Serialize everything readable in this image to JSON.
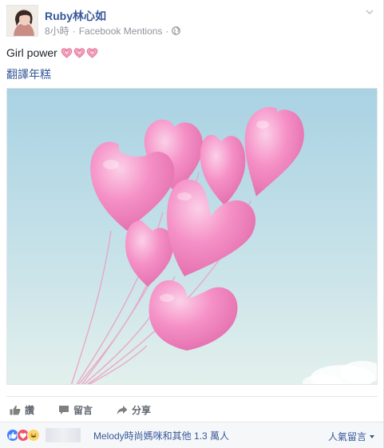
{
  "post": {
    "author": "Ruby林心如",
    "time": "8小時",
    "source": "Facebook Mentions",
    "separator": "·",
    "text": "Girl power",
    "translate_link": "翻譯年糕"
  },
  "actions": {
    "like_label": "讚",
    "comment_label": "留言",
    "share_label": "分享"
  },
  "reactions": {
    "summary": "Melody時尚媽咪和其他 1.3 萬人",
    "top_comments_label": "人氣留言"
  },
  "icons": {
    "globe": "globe-icon",
    "chevron": "chevron-down-icon",
    "like": "thumbs-up-icon",
    "comment": "comment-icon",
    "share": "share-icon",
    "reaction_like": "like-reaction-icon",
    "reaction_love": "love-reaction-icon",
    "reaction_haha": "haha-reaction-icon"
  },
  "colors": {
    "link_blue": "#365899",
    "meta_gray": "#90949c",
    "like_blue": "#4080ff",
    "love_red": "#f25268",
    "haha_yellow": "#fcd669",
    "balloon_pink": "#f48cc4",
    "sky_top": "#a9d2e3",
    "sky_bottom": "#e3f0ec"
  }
}
